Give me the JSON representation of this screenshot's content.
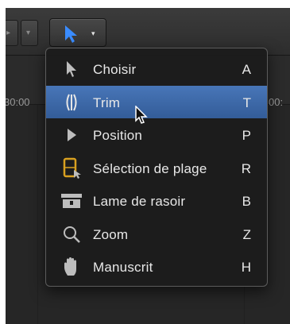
{
  "toolbar": {
    "tool_button_icon": "arrow-icon",
    "caret": "▾",
    "prev_caret": "▾",
    "prev_glyph": "▸"
  },
  "ruler": {
    "left_time": "30:00",
    "right_time": "00:"
  },
  "menu": {
    "items": [
      {
        "label": "Choisir",
        "shortcut": "A",
        "icon": "arrow-icon"
      },
      {
        "label": "Trim",
        "shortcut": "T",
        "icon": "trim-icon",
        "selected": true
      },
      {
        "label": "Position",
        "shortcut": "P",
        "icon": "position-icon"
      },
      {
        "label": "Sélection de plage",
        "shortcut": "R",
        "icon": "range-selection-icon"
      },
      {
        "label": "Lame de rasoir",
        "shortcut": "B",
        "icon": "blade-icon"
      },
      {
        "label": "Zoom",
        "shortcut": "Z",
        "icon": "zoom-icon"
      },
      {
        "label": "Manuscrit",
        "shortcut": "H",
        "icon": "hand-icon"
      }
    ]
  },
  "colors": {
    "selection": "#3f6cae",
    "tool_button_arrow": "#3a8cff",
    "range_icon": "#d8a020"
  }
}
